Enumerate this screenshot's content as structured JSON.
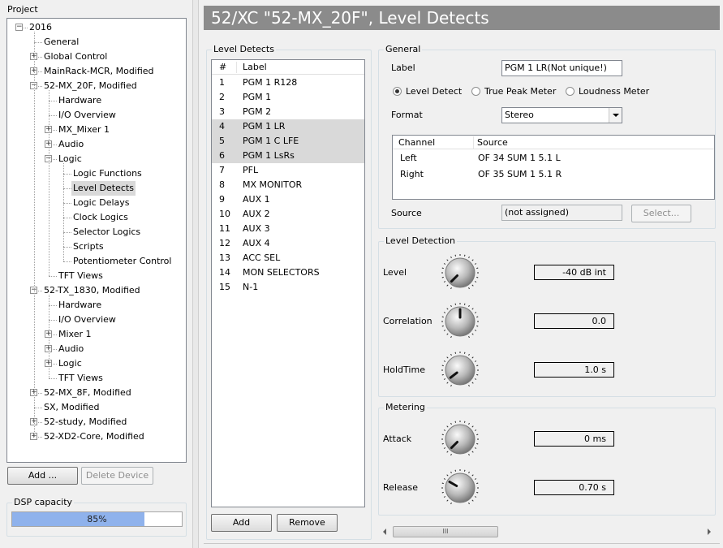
{
  "left_panel": {
    "project_title": "Project",
    "tree": [
      {
        "label": "2016",
        "depth": 0,
        "expander": "minus"
      },
      {
        "label": "General",
        "depth": 1,
        "expander": "none"
      },
      {
        "label": "Global Control",
        "depth": 1,
        "expander": "plus"
      },
      {
        "label": "MainRack-MCR, Modified",
        "depth": 1,
        "expander": "plus"
      },
      {
        "label": "52-MX_20F, Modified",
        "depth": 1,
        "expander": "minus"
      },
      {
        "label": "Hardware",
        "depth": 2,
        "expander": "none"
      },
      {
        "label": "I/O Overview",
        "depth": 2,
        "expander": "none"
      },
      {
        "label": "MX_Mixer 1",
        "depth": 2,
        "expander": "plus"
      },
      {
        "label": "Audio",
        "depth": 2,
        "expander": "plus"
      },
      {
        "label": "Logic",
        "depth": 2,
        "expander": "minus"
      },
      {
        "label": "Logic Functions",
        "depth": 3,
        "expander": "none"
      },
      {
        "label": "Level Detects",
        "depth": 3,
        "expander": "none",
        "selected": true
      },
      {
        "label": "Logic Delays",
        "depth": 3,
        "expander": "none"
      },
      {
        "label": "Clock Logics",
        "depth": 3,
        "expander": "none"
      },
      {
        "label": "Selector Logics",
        "depth": 3,
        "expander": "none"
      },
      {
        "label": "Scripts",
        "depth": 3,
        "expander": "none"
      },
      {
        "label": "Potentiometer Control",
        "depth": 3,
        "expander": "none"
      },
      {
        "label": "TFT Views",
        "depth": 2,
        "expander": "none"
      },
      {
        "label": "52-TX_1830, Modified",
        "depth": 1,
        "expander": "minus"
      },
      {
        "label": "Hardware",
        "depth": 2,
        "expander": "none"
      },
      {
        "label": "I/O Overview",
        "depth": 2,
        "expander": "none"
      },
      {
        "label": "Mixer 1",
        "depth": 2,
        "expander": "plus"
      },
      {
        "label": "Audio",
        "depth": 2,
        "expander": "plus"
      },
      {
        "label": "Logic",
        "depth": 2,
        "expander": "plus"
      },
      {
        "label": "TFT Views",
        "depth": 2,
        "expander": "none"
      },
      {
        "label": "52-MX_8F, Modified",
        "depth": 1,
        "expander": "plus"
      },
      {
        "label": "SX, Modified",
        "depth": 1,
        "expander": "none"
      },
      {
        "label": "52-study, Modified",
        "depth": 1,
        "expander": "plus"
      },
      {
        "label": "52-XD2-Core, Modified",
        "depth": 1,
        "expander": "plus"
      }
    ],
    "add_button": "Add ...",
    "delete_button": "Delete Device",
    "dsp_title": "DSP capacity",
    "dsp_percent_text": "85%",
    "dsp_fraction": 0.85
  },
  "header": {
    "title": "52/XC \"52-MX_20F\", Level Detects"
  },
  "level_detects": {
    "group_title": "Level Detects",
    "col_num": "#",
    "col_label": "Label",
    "rows": [
      {
        "n": "1",
        "label": "PGM 1 R128",
        "selected": false
      },
      {
        "n": "2",
        "label": "PGM 1",
        "selected": false
      },
      {
        "n": "3",
        "label": "PGM 2",
        "selected": false
      },
      {
        "n": "4",
        "label": "PGM 1 LR",
        "selected": true
      },
      {
        "n": "5",
        "label": "PGM 1 C LFE",
        "selected": true
      },
      {
        "n": "6",
        "label": "PGM 1 LsRs",
        "selected": true
      },
      {
        "n": "7",
        "label": "PFL",
        "selected": false
      },
      {
        "n": "8",
        "label": "MX MONITOR",
        "selected": false
      },
      {
        "n": "9",
        "label": "AUX 1",
        "selected": false
      },
      {
        "n": "10",
        "label": "AUX 2",
        "selected": false
      },
      {
        "n": "11",
        "label": "AUX 3",
        "selected": false
      },
      {
        "n": "12",
        "label": "AUX 4",
        "selected": false
      },
      {
        "n": "13",
        "label": "ACC SEL",
        "selected": false
      },
      {
        "n": "14",
        "label": "MON SELECTORS",
        "selected": false
      },
      {
        "n": "15",
        "label": "N-1",
        "selected": false
      }
    ],
    "add_button": "Add",
    "remove_button": "Remove"
  },
  "general": {
    "group_title": "General",
    "label_caption": "Label",
    "label_value": "PGM 1 LR(Not unique!)",
    "radio_level_detect": "Level Detect",
    "radio_true_peak": "True Peak Meter",
    "radio_loudness": "Loudness Meter",
    "selected_mode": "level_detect",
    "format_caption": "Format",
    "format_value": "Stereo",
    "table_col_channel": "Channel",
    "table_col_source": "Source",
    "channels": [
      {
        "channel": "Left",
        "source": "OF 34 SUM 1 5.1 L"
      },
      {
        "channel": "Right",
        "source": "OF 35 SUM 1 5.1 R"
      }
    ],
    "source_caption": "Source",
    "source_value": "(not assigned)",
    "select_button": "Select..."
  },
  "level_detection": {
    "group_title": "Level Detection",
    "level_caption": "Level",
    "level_value": "-40 dB int",
    "correlation_caption": "Correlation",
    "correlation_value": "0.0",
    "holdtime_caption": "HoldTime",
    "holdtime_value": "1.0 s"
  },
  "metering": {
    "group_title": "Metering",
    "attack_caption": "Attack",
    "attack_value": "0 ms",
    "release_caption": "Release",
    "release_value": "0.70 s"
  },
  "scrollbar": {
    "grip": "III"
  },
  "icons": {
    "expand": "plus-icon",
    "collapse": "minus-icon",
    "dropdown": "triangle-down-icon",
    "scroll_left": "triangle-left-icon",
    "scroll_right": "triangle-right-icon"
  }
}
